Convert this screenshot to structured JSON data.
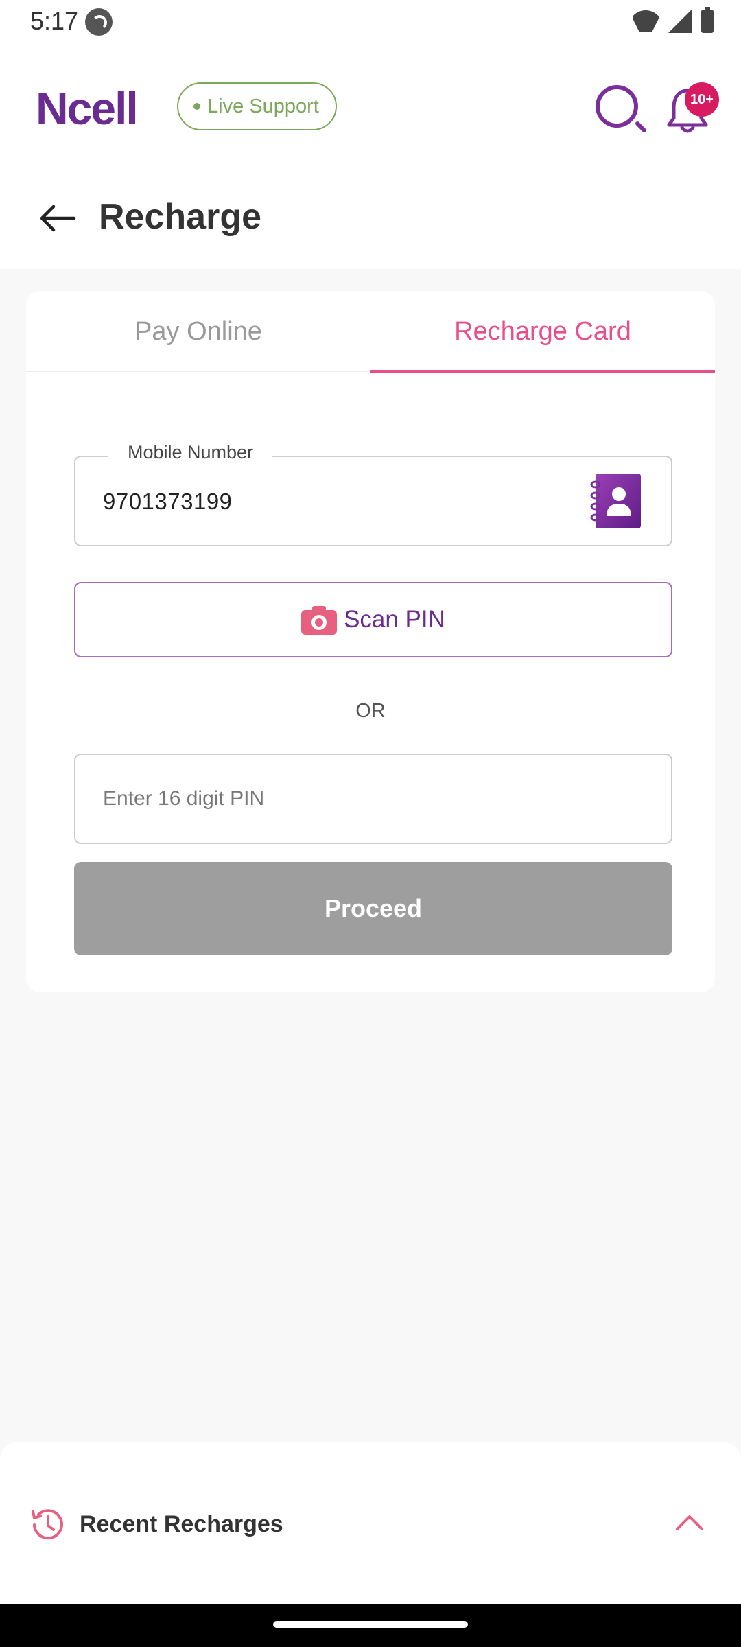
{
  "status_bar": {
    "time": "5:17"
  },
  "header": {
    "logo": "Ncell",
    "live_support_label": "Live Support",
    "notification_badge": "10+",
    "page_title": "Recharge"
  },
  "tabs": [
    {
      "label": "Pay Online",
      "active": false
    },
    {
      "label": "Recharge Card",
      "active": true
    }
  ],
  "form": {
    "mobile_label": "Mobile Number",
    "mobile_value": "9701373199",
    "scan_pin_label": "Scan PIN",
    "or_label": "OR",
    "pin_placeholder": "Enter 16 digit PIN",
    "proceed_label": "Proceed"
  },
  "recent": {
    "title": "Recent Recharges"
  },
  "colors": {
    "brand_purple": "#6b2c91",
    "accent_pink": "#e94e8a",
    "live_green": "#7ba85a",
    "badge_red": "#d81b60",
    "disabled_gray": "#9e9e9e"
  }
}
